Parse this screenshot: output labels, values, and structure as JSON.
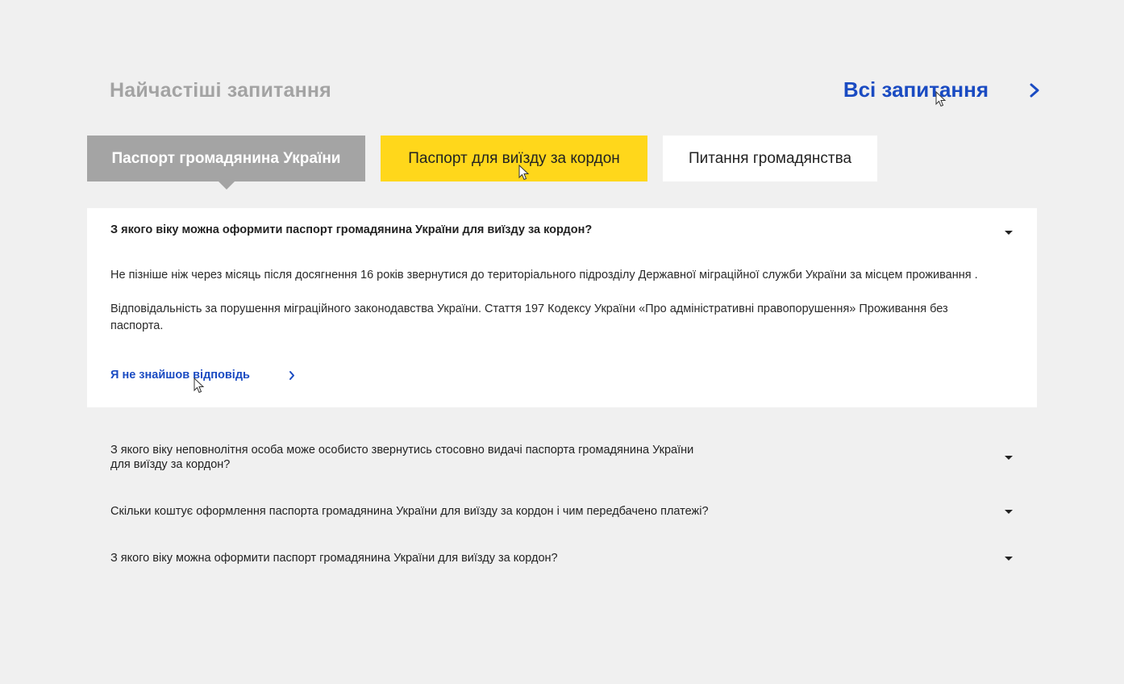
{
  "header": {
    "title": "Найчастіші запитання",
    "all_questions_label": "Всі запитання"
  },
  "tabs": [
    {
      "label": "Паспорт громадянина України",
      "state": "selected"
    },
    {
      "label": "Паспорт для виїзду за кордон",
      "state": "hover"
    },
    {
      "label": "Питання громадянства",
      "state": "default"
    }
  ],
  "faq": [
    {
      "question": "З якого віку можна оформити паспорт громадянина України для виїзду за кордон?",
      "expanded": true,
      "answer": [
        " Не пізніше ніж через місяць після досягнення 16 років звернутися до територіального підрозділу Державної міграційної служби України за місцем проживання .",
        "Відповідальність за порушення міграційного законодавства України. Стаття 197 Кодексу України «Про адміністративні правопорушення» Проживання без паспорта."
      ],
      "not_found_label": "Я не знайшов відповідь"
    },
    {
      "question": "З якого віку неповнолітня особа може особисто звернутись стосовно видачі паспорта громадянина України для виїзду за кордон?",
      "expanded": false
    },
    {
      "question": "Скільки коштує оформлення паспорта громадянина України для виїзду за кордон і чим передбачено платежі?",
      "expanded": false
    },
    {
      "question": "З якого віку можна оформити паспорт громадянина України для виїзду за кордон?",
      "expanded": false
    }
  ],
  "colors": {
    "background": "#f0f0f0",
    "accent_blue": "#1a4bc2",
    "tab_selected": "#a4a4a4",
    "tab_hover": "#ffd71b",
    "tab_default": "#ffffff"
  },
  "icons": [
    "chevron-right-icon",
    "caret-down-icon",
    "mouse-cursor-icon"
  ]
}
